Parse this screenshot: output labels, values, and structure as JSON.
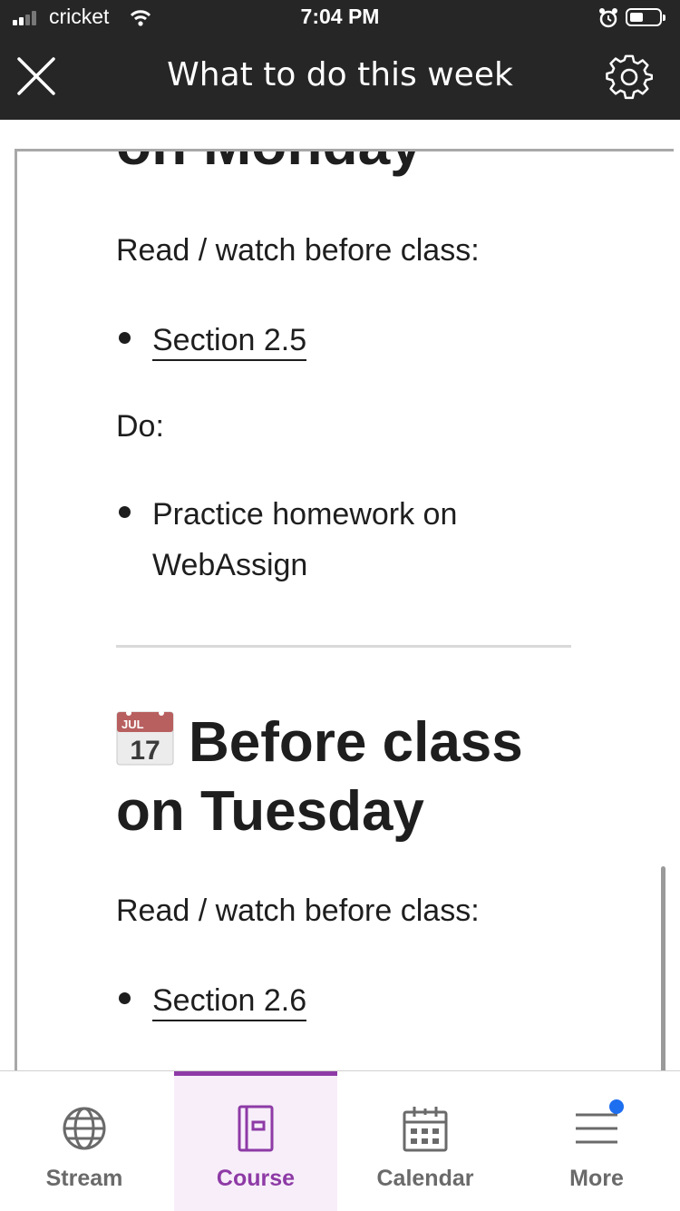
{
  "status_bar": {
    "carrier": "cricket",
    "time": "7:04 PM"
  },
  "header": {
    "title": "What to do this week"
  },
  "content": {
    "cut_heading": "on Monday",
    "monday_read_label": "Read / watch before class:",
    "monday_section_link": "Section 2.5",
    "monday_do_label": "Do:",
    "monday_do_item_line1": "Practice homework on",
    "monday_do_item_line2": "WebAssign",
    "calendar_emoji": {
      "month": "JUL",
      "day": "17"
    },
    "tuesday_heading": "Before class on Tuesday",
    "tuesday_read_label": "Read / watch before class:",
    "tuesday_section_link": "Section 2.6"
  },
  "tabs": [
    {
      "label": "Stream",
      "icon": "globe-icon",
      "active": false
    },
    {
      "label": "Course",
      "icon": "course-book-icon",
      "active": true
    },
    {
      "label": "Calendar",
      "icon": "calendar-icon",
      "active": false
    },
    {
      "label": "More",
      "icon": "menu-icon",
      "active": false,
      "notification": true
    }
  ],
  "colors": {
    "accent": "#8e3aa6",
    "header_bg": "#262626",
    "notification": "#1e6ef0"
  }
}
